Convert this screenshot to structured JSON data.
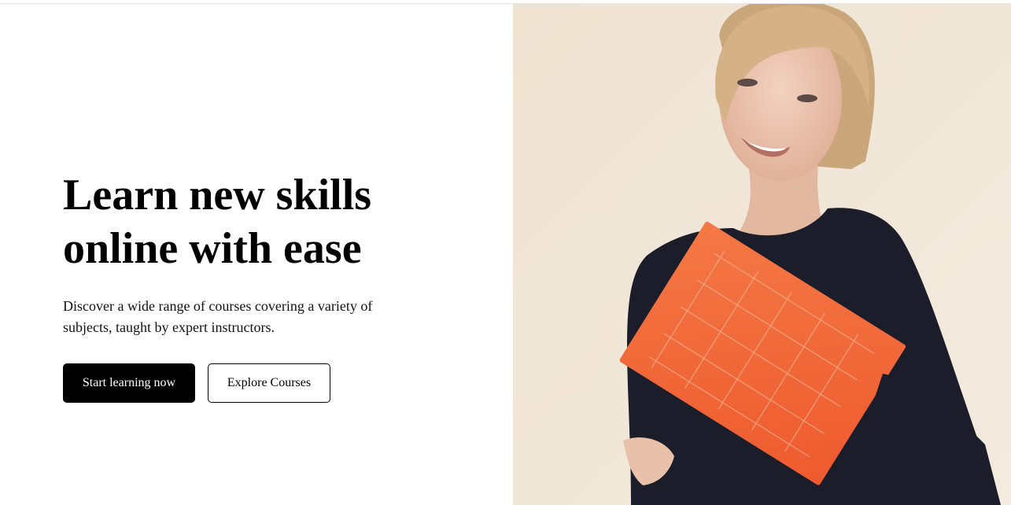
{
  "hero": {
    "headline_line1": "Learn new skills",
    "headline_line2": "online with ease",
    "subtitle": "Discover a wide range of courses covering a variety of subjects, taught by expert instructors.",
    "primary_button": "Start learning now",
    "secondary_button": "Explore Courses"
  },
  "image": {
    "subject": "smiling-woman-holding-orange-notebook"
  },
  "colors": {
    "background": "#ffffff",
    "primary_button_bg": "#000000",
    "primary_button_text": "#ffffff",
    "image_backdrop": "#f0e6d7",
    "sweater": "#1c1d2a",
    "notebook": "#f0643a"
  }
}
